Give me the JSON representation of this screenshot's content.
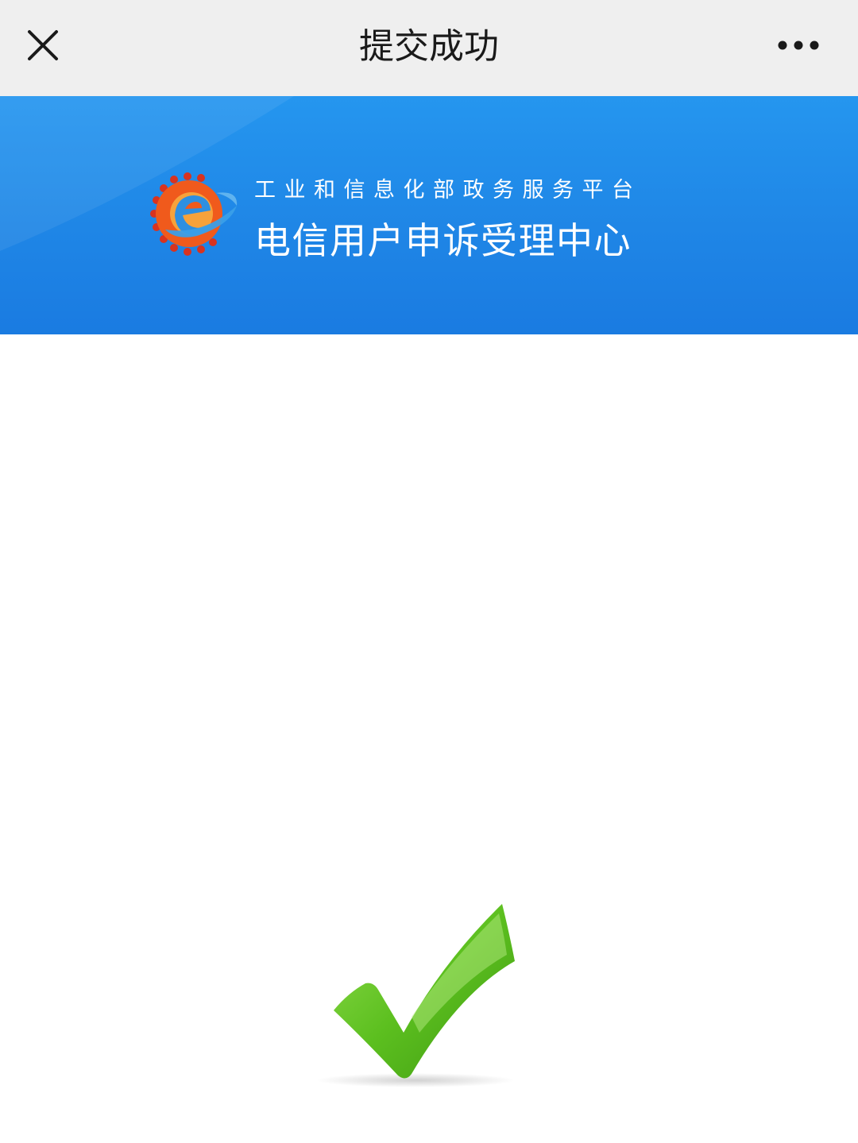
{
  "topbar": {
    "title": "提交成功",
    "close_icon": "close-icon",
    "more_icon": "more-dots-icon"
  },
  "banner": {
    "subtitle": "工业和信息化部政务服务平台",
    "title": "电信用户申诉受理中心",
    "logo_icon": "e-gear-logo",
    "colors": {
      "background": "#1f86e6",
      "logo_orange": "#f05a1c",
      "logo_red": "#d8331f",
      "logo_blue": "#2e8fe0"
    }
  },
  "main": {
    "success_icon": "checkmark-icon",
    "success_color": "#5cbf1f"
  }
}
